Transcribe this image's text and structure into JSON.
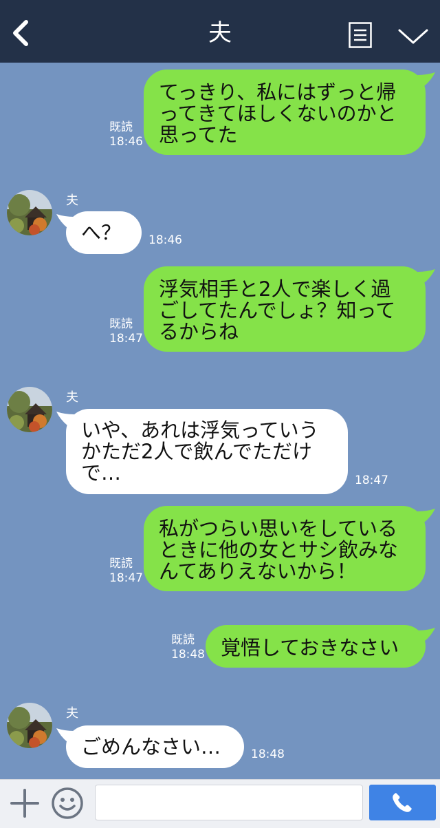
{
  "header": {
    "title": "夫"
  },
  "colors": {
    "header_bg": "#233148",
    "chat_bg": "#7494c0",
    "my_bubble": "#85e249",
    "their_bubble": "#ffffff",
    "call_button": "#3f83e5"
  },
  "messages": [
    {
      "from": "me",
      "lines": [
        "てっきり、私にはずっと帰",
        "ってきてほしくないのかと",
        "思ってた"
      ],
      "read": "既読",
      "time": "18:46"
    },
    {
      "from": "them",
      "sender": "夫",
      "lines": [
        "へ？"
      ],
      "time": "18:46"
    },
    {
      "from": "me",
      "lines": [
        "浮気相手と2人で楽しく過",
        "ごしてたんでしょ？知って",
        "るからね"
      ],
      "read": "既読",
      "time": "18:47"
    },
    {
      "from": "them",
      "sender": "夫",
      "lines": [
        "いや、あれは浮気っていう",
        "かただ2人で飲んでただけ",
        "で…"
      ],
      "time": "18:47"
    },
    {
      "from": "me",
      "lines": [
        "私がつらい思いをしている",
        "ときに他の女とサシ飲みな",
        "んてありえないから！"
      ],
      "read": "既読",
      "time": "18:47"
    },
    {
      "from": "me",
      "lines": [
        "覚悟しておきなさい"
      ],
      "read": "既読",
      "time": "18:48"
    },
    {
      "from": "them",
      "sender": "夫",
      "lines": [
        "ごめんなさい…"
      ],
      "time": "18:48"
    }
  ],
  "input": {
    "placeholder": ""
  },
  "icons": {
    "back": "back-chevron-icon",
    "menu": "menu-list-icon",
    "collapse": "chevron-down-icon",
    "add": "plus-icon",
    "emoji": "smiley-icon",
    "call": "phone-icon"
  }
}
